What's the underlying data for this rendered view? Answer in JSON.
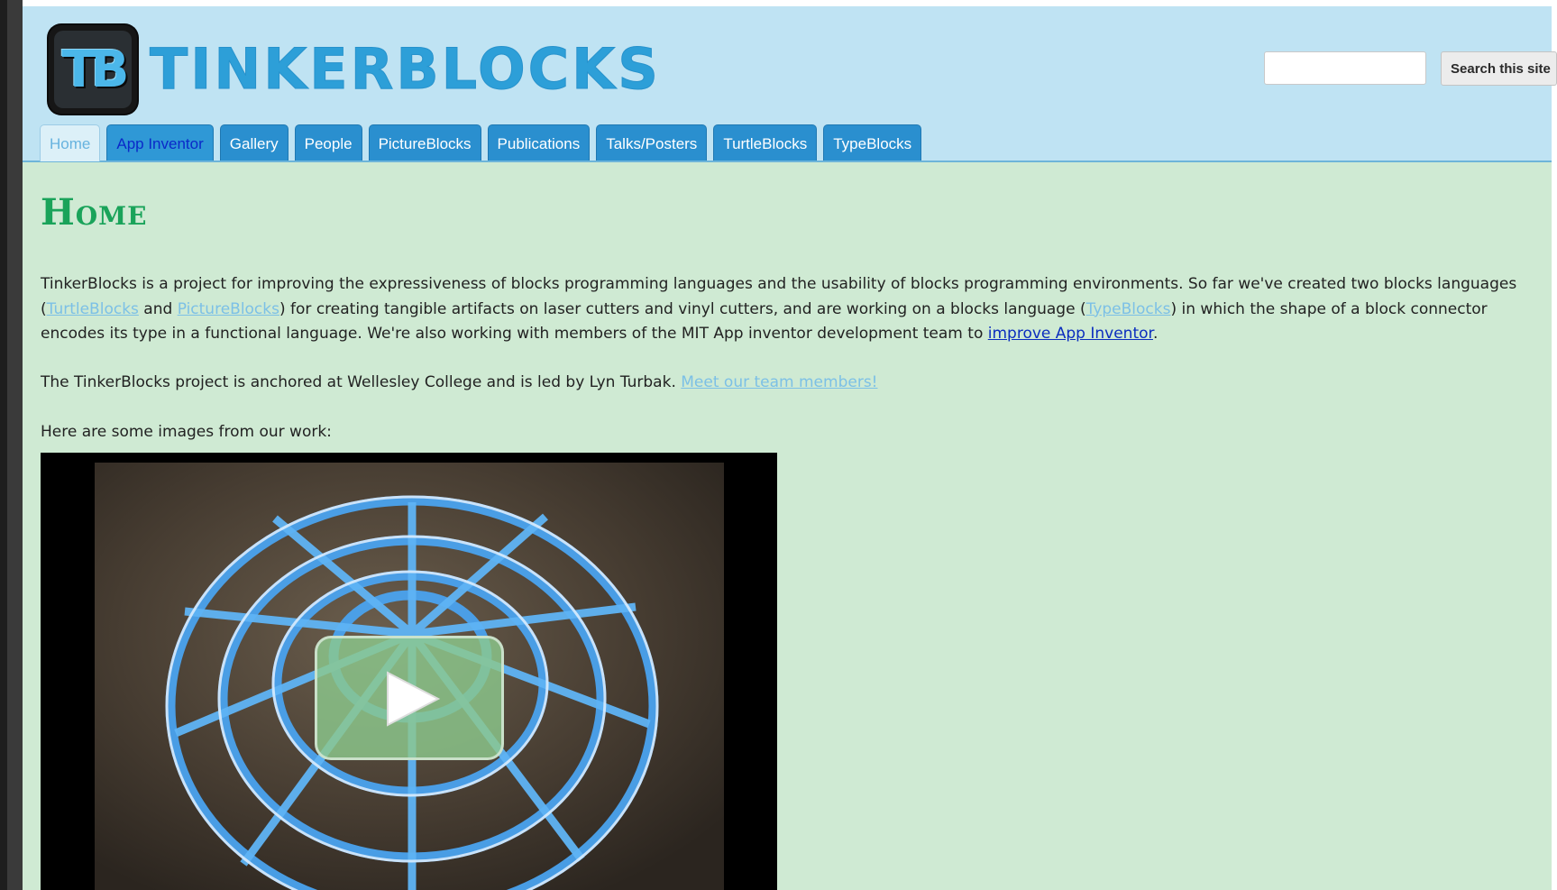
{
  "header": {
    "logo_text": "TB",
    "site_title": "TINKERBLOCKS",
    "search": {
      "placeholder": "",
      "button_label": "Search this site"
    }
  },
  "nav": {
    "tabs": [
      {
        "label": "Home",
        "active": true
      },
      {
        "label": "App Inventor"
      },
      {
        "label": "Gallery"
      },
      {
        "label": "People"
      },
      {
        "label": "PictureBlocks"
      },
      {
        "label": "Publications"
      },
      {
        "label": "Talks/Posters"
      },
      {
        "label": "TurtleBlocks"
      },
      {
        "label": "TypeBlocks"
      }
    ]
  },
  "main": {
    "title": "Home",
    "para1": {
      "t1": "TinkerBlocks is a project for improving the expressiveness of blocks programming languages and the usability of blocks programming environments.  So far we've created two blocks languages (",
      "link_turtle": "TurtleBlocks",
      "t2": " and ",
      "link_picture": "PictureBlocks",
      "t3": ") for creating tangible artifacts on laser cutters and vinyl cutters, and are working on a blocks language (",
      "link_type": "TypeBlocks",
      "t4": ") in which the shape of a block connector encodes its type in a functional language.  We're also working with members of the MIT App inventor development team to ",
      "link_improve": "improve App Inventor",
      "t5": "."
    },
    "para2": {
      "text": "The TinkerBlocks project is anchored at Wellesley College and is led by Lyn Turbak.  ",
      "link_team": "Meet our team members!"
    },
    "para3": "Here are some images from our work:"
  },
  "colors": {
    "header_bg": "#bfe3f3",
    "content_bg": "#cfead3",
    "title_green": "#1aa35a",
    "tab_blue": "#2a8fcf"
  }
}
